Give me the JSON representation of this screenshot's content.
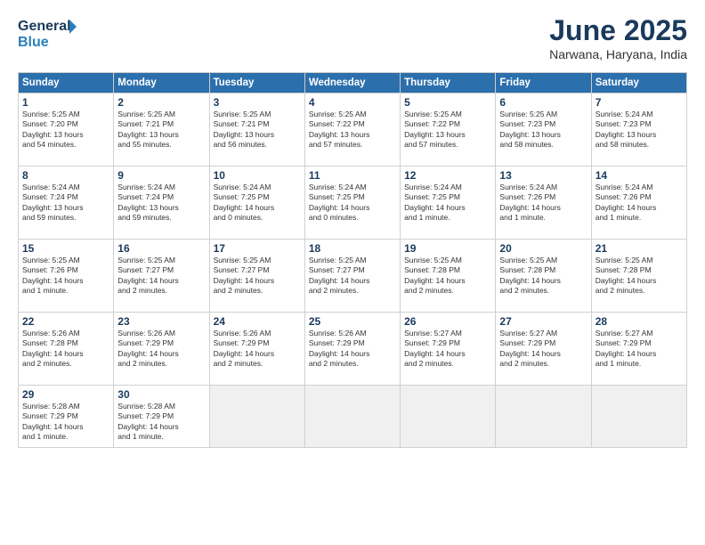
{
  "logo": {
    "line1": "General",
    "line2": "Blue"
  },
  "title": "June 2025",
  "location": "Narwana, Haryana, India",
  "weekdays": [
    "Sunday",
    "Monday",
    "Tuesday",
    "Wednesday",
    "Thursday",
    "Friday",
    "Saturday"
  ],
  "weeks": [
    [
      {
        "day": "1",
        "info": "Sunrise: 5:25 AM\nSunset: 7:20 PM\nDaylight: 13 hours\nand 54 minutes."
      },
      {
        "day": "2",
        "info": "Sunrise: 5:25 AM\nSunset: 7:21 PM\nDaylight: 13 hours\nand 55 minutes."
      },
      {
        "day": "3",
        "info": "Sunrise: 5:25 AM\nSunset: 7:21 PM\nDaylight: 13 hours\nand 56 minutes."
      },
      {
        "day": "4",
        "info": "Sunrise: 5:25 AM\nSunset: 7:22 PM\nDaylight: 13 hours\nand 57 minutes."
      },
      {
        "day": "5",
        "info": "Sunrise: 5:25 AM\nSunset: 7:22 PM\nDaylight: 13 hours\nand 57 minutes."
      },
      {
        "day": "6",
        "info": "Sunrise: 5:25 AM\nSunset: 7:23 PM\nDaylight: 13 hours\nand 58 minutes."
      },
      {
        "day": "7",
        "info": "Sunrise: 5:24 AM\nSunset: 7:23 PM\nDaylight: 13 hours\nand 58 minutes."
      }
    ],
    [
      {
        "day": "8",
        "info": "Sunrise: 5:24 AM\nSunset: 7:24 PM\nDaylight: 13 hours\nand 59 minutes."
      },
      {
        "day": "9",
        "info": "Sunrise: 5:24 AM\nSunset: 7:24 PM\nDaylight: 13 hours\nand 59 minutes."
      },
      {
        "day": "10",
        "info": "Sunrise: 5:24 AM\nSunset: 7:25 PM\nDaylight: 14 hours\nand 0 minutes."
      },
      {
        "day": "11",
        "info": "Sunrise: 5:24 AM\nSunset: 7:25 PM\nDaylight: 14 hours\nand 0 minutes."
      },
      {
        "day": "12",
        "info": "Sunrise: 5:24 AM\nSunset: 7:25 PM\nDaylight: 14 hours\nand 1 minute."
      },
      {
        "day": "13",
        "info": "Sunrise: 5:24 AM\nSunset: 7:26 PM\nDaylight: 14 hours\nand 1 minute."
      },
      {
        "day": "14",
        "info": "Sunrise: 5:24 AM\nSunset: 7:26 PM\nDaylight: 14 hours\nand 1 minute."
      }
    ],
    [
      {
        "day": "15",
        "info": "Sunrise: 5:25 AM\nSunset: 7:26 PM\nDaylight: 14 hours\nand 1 minute."
      },
      {
        "day": "16",
        "info": "Sunrise: 5:25 AM\nSunset: 7:27 PM\nDaylight: 14 hours\nand 2 minutes."
      },
      {
        "day": "17",
        "info": "Sunrise: 5:25 AM\nSunset: 7:27 PM\nDaylight: 14 hours\nand 2 minutes."
      },
      {
        "day": "18",
        "info": "Sunrise: 5:25 AM\nSunset: 7:27 PM\nDaylight: 14 hours\nand 2 minutes."
      },
      {
        "day": "19",
        "info": "Sunrise: 5:25 AM\nSunset: 7:28 PM\nDaylight: 14 hours\nand 2 minutes."
      },
      {
        "day": "20",
        "info": "Sunrise: 5:25 AM\nSunset: 7:28 PM\nDaylight: 14 hours\nand 2 minutes."
      },
      {
        "day": "21",
        "info": "Sunrise: 5:25 AM\nSunset: 7:28 PM\nDaylight: 14 hours\nand 2 minutes."
      }
    ],
    [
      {
        "day": "22",
        "info": "Sunrise: 5:26 AM\nSunset: 7:28 PM\nDaylight: 14 hours\nand 2 minutes."
      },
      {
        "day": "23",
        "info": "Sunrise: 5:26 AM\nSunset: 7:29 PM\nDaylight: 14 hours\nand 2 minutes."
      },
      {
        "day": "24",
        "info": "Sunrise: 5:26 AM\nSunset: 7:29 PM\nDaylight: 14 hours\nand 2 minutes."
      },
      {
        "day": "25",
        "info": "Sunrise: 5:26 AM\nSunset: 7:29 PM\nDaylight: 14 hours\nand 2 minutes."
      },
      {
        "day": "26",
        "info": "Sunrise: 5:27 AM\nSunset: 7:29 PM\nDaylight: 14 hours\nand 2 minutes."
      },
      {
        "day": "27",
        "info": "Sunrise: 5:27 AM\nSunset: 7:29 PM\nDaylight: 14 hours\nand 2 minutes."
      },
      {
        "day": "28",
        "info": "Sunrise: 5:27 AM\nSunset: 7:29 PM\nDaylight: 14 hours\nand 1 minute."
      }
    ],
    [
      {
        "day": "29",
        "info": "Sunrise: 5:28 AM\nSunset: 7:29 PM\nDaylight: 14 hours\nand 1 minute."
      },
      {
        "day": "30",
        "info": "Sunrise: 5:28 AM\nSunset: 7:29 PM\nDaylight: 14 hours\nand 1 minute."
      },
      null,
      null,
      null,
      null,
      null
    ]
  ]
}
